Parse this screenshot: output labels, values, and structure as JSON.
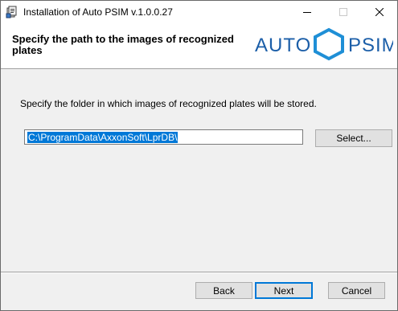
{
  "window": {
    "title": "Installation of Auto PSIM v.1.0.0.27"
  },
  "header": {
    "title": "Specify the path to the images of recognized plates",
    "logo_left": "AUTO",
    "logo_right": "PSIM",
    "brand_color": "#1b5ea8"
  },
  "main": {
    "instruction": "Specify the folder in which images of recognized plates will be stored.",
    "path_value": "C:\\ProgramData\\AxxonSoft\\LprDB\\",
    "select_label": "Select..."
  },
  "footer": {
    "back_label": "Back",
    "next_label": "Next",
    "cancel_label": "Cancel"
  },
  "icons": {
    "app": "installer-icon",
    "minimize": "minimize-icon",
    "maximize": "maximize-icon",
    "close": "close-icon",
    "logo_mark": "hexagon-icon"
  }
}
